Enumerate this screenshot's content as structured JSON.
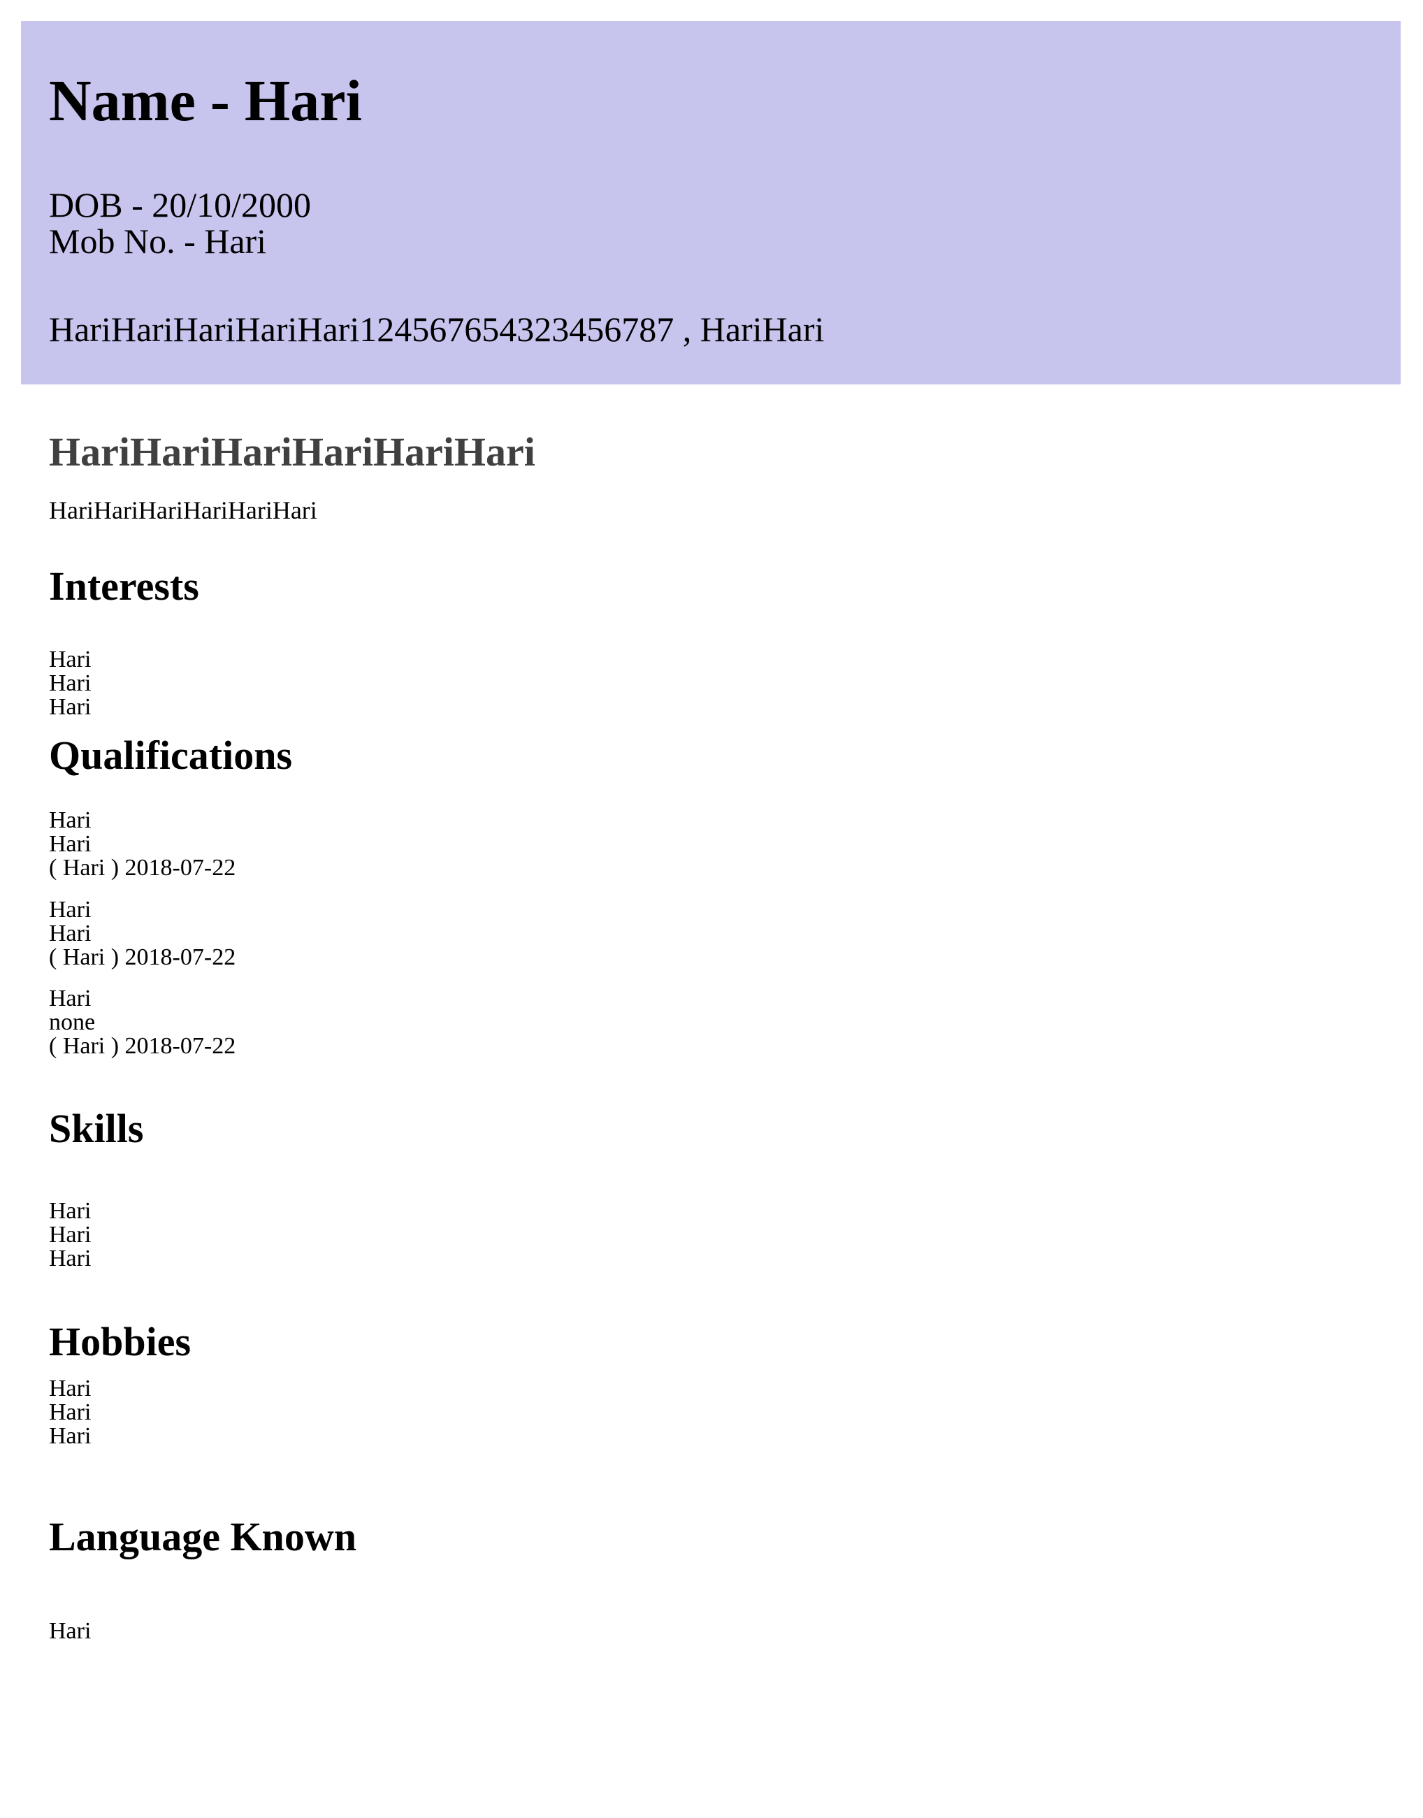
{
  "header": {
    "name_label": "Name - Hari",
    "dob_label": "DOB - 20/10/2000",
    "mobile_label": "Mob No. - Hari",
    "address_label": "HariHariHariHariHari124567654323456787 , HariHari"
  },
  "summary": {
    "heading": "HariHariHariHariHariHari",
    "text": "HariHariHariHariHariHari"
  },
  "interests": {
    "heading": "Interests",
    "items": [
      "Hari",
      "Hari",
      "Hari"
    ]
  },
  "qualifications": {
    "heading": "Qualifications",
    "entries": [
      {
        "title": "Hari",
        "detail": "Hari",
        "meta": "( Hari )  2018-07-22"
      },
      {
        "title": "Hari",
        "detail": "Hari",
        "meta": "( Hari )  2018-07-22"
      },
      {
        "title": "Hari",
        "detail": "none",
        "meta": "( Hari )  2018-07-22"
      }
    ]
  },
  "skills": {
    "heading": "Skills",
    "items": [
      "Hari",
      "Hari",
      "Hari"
    ]
  },
  "hobbies": {
    "heading": "Hobbies",
    "items": [
      "Hari",
      "Hari",
      "Hari"
    ]
  },
  "languages": {
    "heading": "Language Known",
    "items": [
      "Hari"
    ]
  },
  "colors": {
    "header_background": "#c7c4ee",
    "summary_heading": "#404040"
  }
}
